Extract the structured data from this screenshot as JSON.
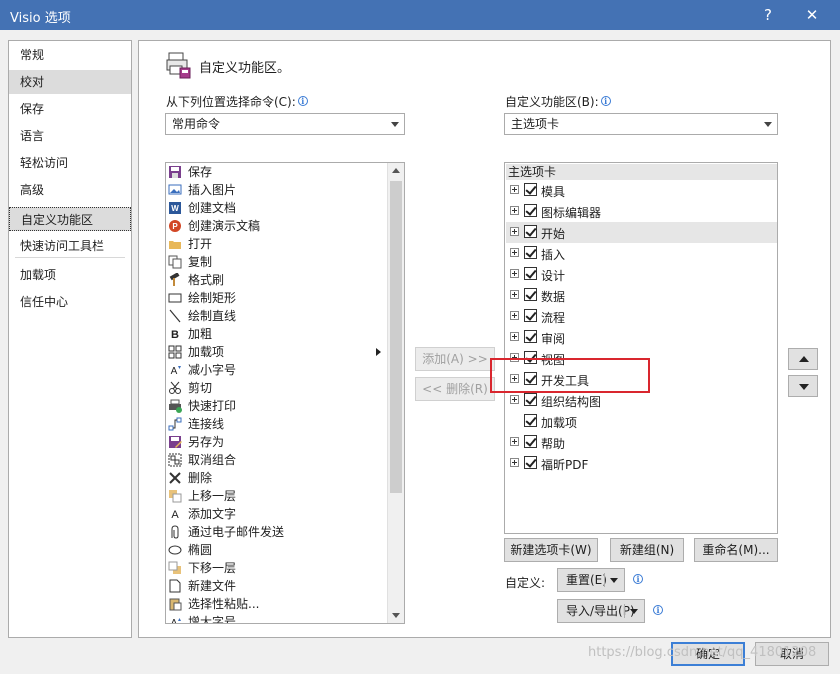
{
  "window": {
    "title": "Visio 选项",
    "help_glyph": "?",
    "close_glyph": "✕"
  },
  "nav": {
    "items": [
      {
        "label": "常规",
        "state": "normal"
      },
      {
        "label": "校对",
        "state": "hover"
      },
      {
        "label": "保存",
        "state": "normal"
      },
      {
        "label": "语言",
        "state": "normal"
      },
      {
        "label": "轻松访问",
        "state": "normal"
      },
      {
        "label": "高级",
        "state": "normal"
      },
      {
        "label": "自定义功能区",
        "state": "selected"
      },
      {
        "label": "快速访问工具栏",
        "state": "normal"
      },
      {
        "label": "加载项",
        "state": "normal"
      },
      {
        "label": "信任中心",
        "state": "normal"
      }
    ]
  },
  "main": {
    "heading": "自定义功能区。",
    "left_label": "从下列位置选择命令(C):",
    "left_combo_value": "常用命令",
    "right_label": "自定义功能区(B):",
    "right_combo_value": "主选项卡"
  },
  "commands": [
    {
      "label": "保存",
      "icon": "save-icon"
    },
    {
      "label": "插入图片",
      "icon": "insert-picture-icon"
    },
    {
      "label": "创建文档",
      "icon": "word-icon"
    },
    {
      "label": "创建演示文稿",
      "icon": "powerpoint-icon"
    },
    {
      "label": "打开",
      "icon": "folder-open-icon"
    },
    {
      "label": "复制",
      "icon": "copy-icon"
    },
    {
      "label": "格式刷",
      "icon": "format-painter-icon"
    },
    {
      "label": "绘制矩形",
      "icon": "rectangle-icon"
    },
    {
      "label": "绘制直线",
      "icon": "line-icon"
    },
    {
      "label": "加粗",
      "icon": "bold-icon"
    },
    {
      "label": "加载项",
      "icon": "addins-icon",
      "submenu": true
    },
    {
      "label": "减小字号",
      "icon": "decrease-font-icon"
    },
    {
      "label": "剪切",
      "icon": "cut-icon"
    },
    {
      "label": "快速打印",
      "icon": "quick-print-icon"
    },
    {
      "label": "连接线",
      "icon": "connector-icon"
    },
    {
      "label": "另存为",
      "icon": "save-as-icon"
    },
    {
      "label": "取消组合",
      "icon": "ungroup-icon"
    },
    {
      "label": "删除",
      "icon": "delete-icon"
    },
    {
      "label": "上移一层",
      "icon": "bring-forward-icon"
    },
    {
      "label": "添加文字",
      "icon": "add-text-icon"
    },
    {
      "label": "通过电子邮件发送",
      "icon": "email-attachment-icon"
    },
    {
      "label": "椭圆",
      "icon": "ellipse-icon"
    },
    {
      "label": "下移一层",
      "icon": "send-backward-icon"
    },
    {
      "label": "新建文件",
      "icon": "new-file-icon"
    },
    {
      "label": "选择性粘贴...",
      "icon": "paste-special-icon"
    },
    {
      "label": "增大字号",
      "icon": "increase-font-icon"
    }
  ],
  "middle": {
    "add_label": "添加(A) >>",
    "remove_label": "<< 删除(R)"
  },
  "tree": {
    "header": "主选项卡",
    "items": [
      {
        "label": "模具",
        "expander": true,
        "checked": true
      },
      {
        "label": "图标编辑器",
        "expander": true,
        "checked": true
      },
      {
        "label": "开始",
        "expander": true,
        "checked": true,
        "selected": true
      },
      {
        "label": "插入",
        "expander": true,
        "checked": true
      },
      {
        "label": "设计",
        "expander": true,
        "checked": true
      },
      {
        "label": "数据",
        "expander": true,
        "checked": true
      },
      {
        "label": "流程",
        "expander": true,
        "checked": true
      },
      {
        "label": "审阅",
        "expander": true,
        "checked": true
      },
      {
        "label": "视图",
        "expander": true,
        "checked": true
      },
      {
        "label": "开发工具",
        "expander": true,
        "checked": true
      },
      {
        "label": "组织结构图",
        "expander": true,
        "checked": true
      },
      {
        "label": "加载项",
        "expander": false,
        "checked": true
      },
      {
        "label": "帮助",
        "expander": true,
        "checked": true
      },
      {
        "label": "福昕PDF",
        "expander": true,
        "checked": true
      }
    ]
  },
  "bottom": {
    "new_tab": "新建选项卡(W)",
    "new_group": "新建组(N)",
    "rename": "重命名(M)...",
    "customize_label": "自定义:",
    "reset": "重置(E)",
    "import_export": "导入/导出(P)"
  },
  "footer": {
    "ok": "确定",
    "cancel": "取消"
  },
  "watermark": "https://blog.csdn.net/qq_41801208"
}
